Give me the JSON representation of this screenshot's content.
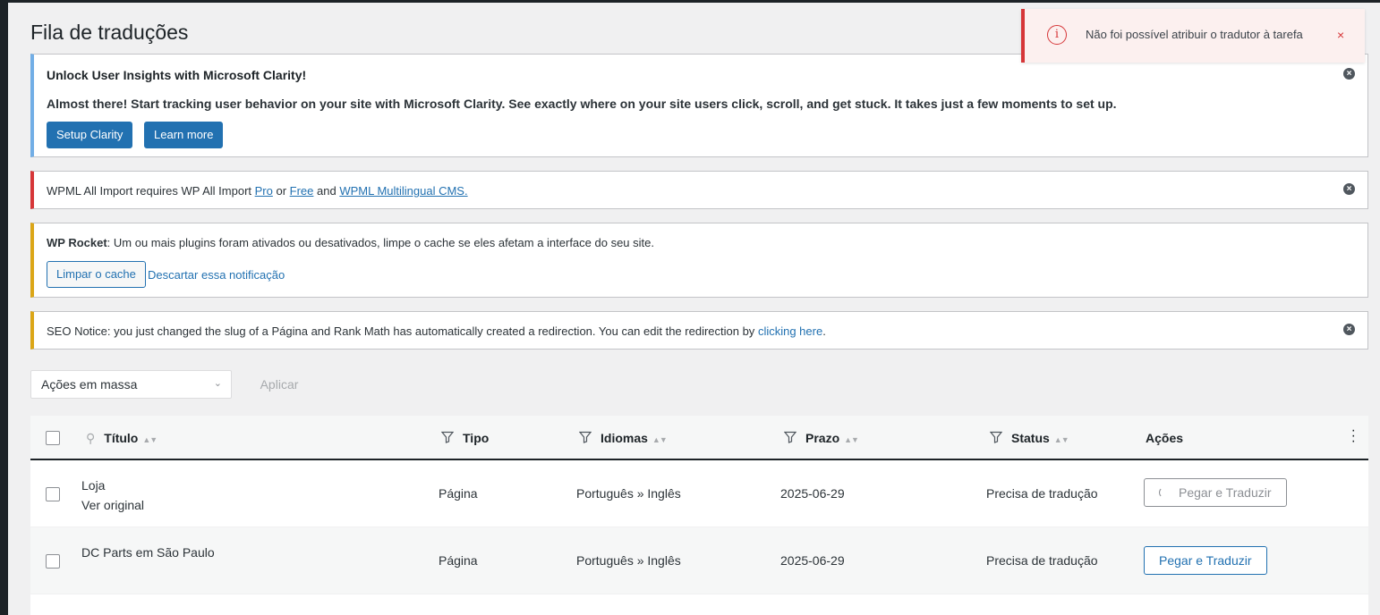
{
  "page": {
    "title": "Fila de traduções"
  },
  "toast": {
    "message": "Não foi possível atribuir o tradutor à tarefa",
    "close": "×"
  },
  "notices": {
    "clarity": {
      "heading": "Unlock User Insights with Microsoft Clarity!",
      "text": "Almost there! Start tracking user behavior on your site with Microsoft Clarity. See exactly where on your site users click, scroll, and get stuck. It takes just a few moments to set up.",
      "setup_label": "Setup Clarity",
      "learn_label": "Learn more"
    },
    "wpml": {
      "prefix": "WPML All Import requires WP All Import ",
      "pro": "Pro",
      "or": " or ",
      "free": "Free",
      "and": " and ",
      "cms": "WPML Multilingual CMS."
    },
    "rocket": {
      "brand": "WP Rocket",
      "text": ": Um ou mais plugins foram ativados ou desativados, limpe o cache se eles afetam a interface do seu site.",
      "clear_label": "Limpar o cache",
      "dismiss_label": "Descartar essa notificação"
    },
    "seo": {
      "text": "SEO Notice: you just changed the slug of a Página and Rank Math has automatically created a redirection. You can edit the redirection by ",
      "link": "clicking here",
      "suffix": "."
    }
  },
  "bulk": {
    "select_value": "Ações em massa",
    "apply_label": "Aplicar"
  },
  "table": {
    "headers": {
      "title": "Título",
      "type": "Tipo",
      "languages": "Idiomas",
      "deadline": "Prazo",
      "status": "Status",
      "actions": "Ações"
    },
    "rows": [
      {
        "title": "Loja",
        "view_original": "Ver original",
        "type": "Página",
        "languages": "Português » Inglês",
        "deadline": "2025-06-29",
        "status": "Precisa de tradução",
        "action": "Pegar e Traduzir"
      },
      {
        "title": "DC Parts em São Paulo",
        "type": "Página",
        "languages": "Português » Inglês",
        "deadline": "2025-06-29",
        "status": "Precisa de tradução",
        "action": "Pegar e Traduzir"
      }
    ]
  },
  "colors": {
    "accent": "#2271b1",
    "error": "#d63638",
    "warning": "#dba617",
    "info": "#72aee6"
  }
}
